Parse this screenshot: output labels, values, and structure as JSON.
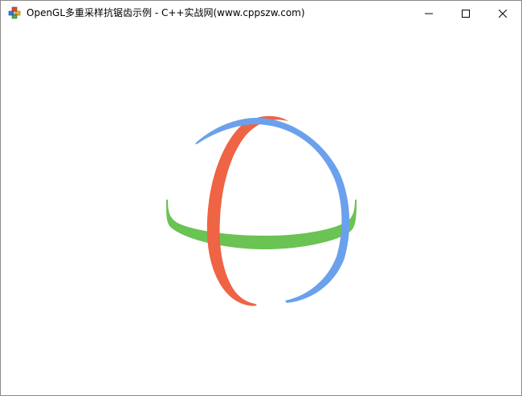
{
  "window": {
    "title": "OpenGL多重采样抗锯齿示例 - C++实战网(www.cppszw.com)",
    "controls": {
      "minimize_icon": "minimize-icon",
      "maximize_icon": "maximize-icon",
      "close_icon": "close-icon"
    }
  },
  "scene": {
    "description_tags": [
      "torus-ring-green",
      "torus-ring-red",
      "torus-ring-blue"
    ],
    "colors": {
      "green": "#6ac353",
      "red": "#ee6445",
      "blue": "#6ba1ec",
      "background": "#ffffff"
    }
  }
}
